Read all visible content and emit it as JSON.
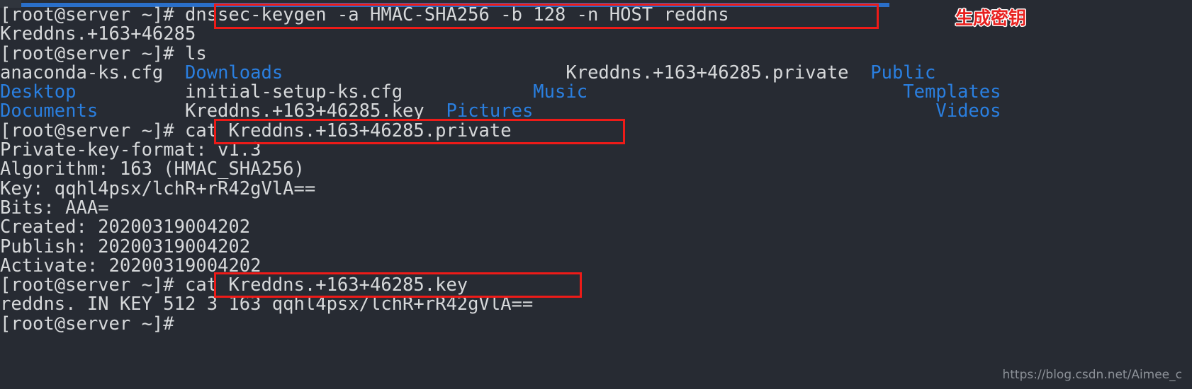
{
  "terminal": {
    "title": "root@server:~",
    "background_color": "#272b33",
    "foreground_color": "#d6d8da",
    "directory_color": "#2a7fe0",
    "accent_bar_color": "#2a6fc9",
    "annotation_color": "#ee1b18",
    "prompt": "[root@server ~]# ",
    "lines": [
      {
        "id": "cmd-keygen",
        "prompt": "[root@server ~]# ",
        "text": "dnssec-keygen -a HMAC-SHA256 -b 128 -n HOST reddns"
      },
      {
        "id": "out-keyname",
        "prompt": "",
        "text": "Kreddns.+163+46285"
      },
      {
        "id": "cmd-ls",
        "prompt": "[root@server ~]# ",
        "text": "ls"
      },
      {
        "id": "cmd-cat-private",
        "prompt": "[root@server ~]# ",
        "text": "cat Kreddns.+163+46285.private"
      },
      {
        "id": "out-privformat",
        "prompt": "",
        "text": "Private-key-format: v1.3"
      },
      {
        "id": "out-algorithm",
        "prompt": "",
        "text": "Algorithm: 163 (HMAC_SHA256)"
      },
      {
        "id": "out-key",
        "prompt": "",
        "text": "Key: qqhl4psx/lchR+rR42gVlA=="
      },
      {
        "id": "out-bits",
        "prompt": "",
        "text": "Bits: AAA="
      },
      {
        "id": "out-created",
        "prompt": "",
        "text": "Created: 20200319004202"
      },
      {
        "id": "out-publish",
        "prompt": "",
        "text": "Publish: 20200319004202"
      },
      {
        "id": "out-activate",
        "prompt": "",
        "text": "Activate: 20200319004202"
      },
      {
        "id": "cmd-cat-key",
        "prompt": "[root@server ~]# ",
        "text": "cat Kreddns.+163+46285.key"
      },
      {
        "id": "out-keyrecord",
        "prompt": "",
        "text": "reddns. IN KEY 512 3 163 qqhl4psx/lchR+rR42gVlA=="
      },
      {
        "id": "prompt-final",
        "prompt": "[root@server ~]# ",
        "text": ""
      }
    ],
    "ls_output": {
      "rows": [
        [
          {
            "name": "anaconda-ks.cfg",
            "type": "file"
          },
          {
            "name": "Downloads",
            "type": "dir"
          },
          {
            "name": "Kreddns.+163+46285.private",
            "type": "file"
          },
          {
            "name": "Public",
            "type": "dir"
          }
        ],
        [
          {
            "name": "Desktop",
            "type": "dir"
          },
          {
            "name": "initial-setup-ks.cfg",
            "type": "file"
          },
          {
            "name": "Music",
            "type": "dir"
          },
          {
            "name": "Templates",
            "type": "dir"
          }
        ],
        [
          {
            "name": "Documents",
            "type": "dir"
          },
          {
            "name": "Kreddns.+163+46285.key",
            "type": "file"
          },
          {
            "name": "Pictures",
            "type": "dir"
          },
          {
            "name": "Videos",
            "type": "dir"
          }
        ]
      ]
    },
    "annotations": {
      "label_generate_key": "生成密钥",
      "highlight_keygen_command": "dnssec-keygen -a HMAC-SHA256 -b 128 -n HOST reddns",
      "highlight_cat_private": "cat Kreddns.+163+46285.private",
      "highlight_cat_key": "cat Kreddns.+163+46285.key"
    },
    "watermark": "https://blog.csdn.net/Aimee_c"
  }
}
